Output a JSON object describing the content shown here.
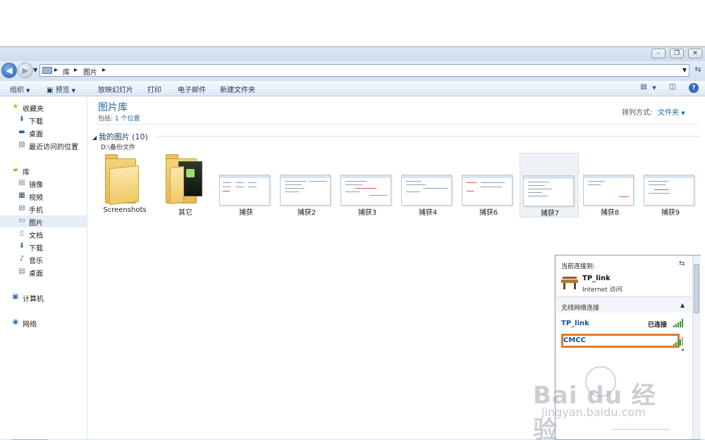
{
  "window": {
    "caption_buttons": [
      "minimize",
      "maximize",
      "close"
    ]
  },
  "address": {
    "crumbs": [
      "库",
      "图片"
    ],
    "separator": "▸"
  },
  "toolbar": {
    "organize": "组织",
    "preview": "预览",
    "slideshow": "放映幻灯片",
    "print": "打印",
    "email": "电子邮件",
    "new_folder": "新建文件夹"
  },
  "sidebar": {
    "favorites": {
      "label": "收藏夹",
      "items": [
        "下载",
        "桌面",
        "最近访问的位置"
      ]
    },
    "libraries": {
      "label": "库",
      "items": [
        "镜像",
        "视频",
        "手机",
        "图片",
        "文档",
        "下载",
        "音乐",
        "桌面"
      ],
      "selected": "图片"
    },
    "computer": "计算机",
    "network": "网络"
  },
  "content": {
    "title": "图片库",
    "includes_label": "包括:",
    "includes_link": "1 个位置",
    "sort_label": "排列方式:",
    "sort_value": "文件夹",
    "group_header": "我的图片 (10)",
    "group_path": "D:\\备份文件",
    "items": [
      {
        "name": "Screenshots",
        "kind": "folder"
      },
      {
        "name": "其它",
        "kind": "folder-photo"
      },
      {
        "name": "捕获",
        "kind": "image"
      },
      {
        "name": "捕获2",
        "kind": "image"
      },
      {
        "name": "捕获3",
        "kind": "image"
      },
      {
        "name": "捕获4",
        "kind": "image"
      },
      {
        "name": "捕获6",
        "kind": "image"
      },
      {
        "name": "捕获7",
        "kind": "image",
        "selected": true
      },
      {
        "name": "捕获8",
        "kind": "image"
      },
      {
        "name": "捕获9",
        "kind": "image"
      }
    ]
  },
  "network_popup": {
    "currently_connected": "当前连接到:",
    "network_name": "TP_link",
    "network_status": "Internet 访问",
    "wireless_header": "无线网络连接",
    "networks": [
      {
        "name": "TP_link",
        "status": "已连接",
        "signal": 5
      },
      {
        "name": "CMCC",
        "status": "",
        "signal": 4,
        "highlighted": true
      }
    ]
  },
  "watermark": {
    "text": "Bai du 经验",
    "url": "jingyan.baidu.com"
  },
  "colors": {
    "accent": "#1e6aa5",
    "highlight_box": "#e07a2c",
    "signal": "#3b9a2c"
  }
}
